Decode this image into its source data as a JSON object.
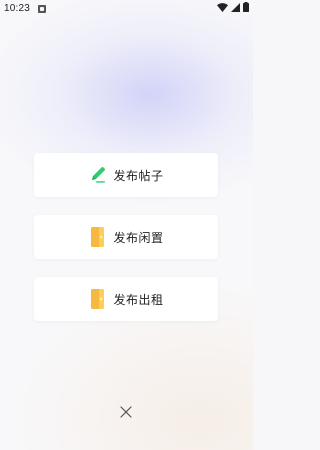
{
  "status_bar": {
    "time": "10:23",
    "icons": [
      "app-notification-icon",
      "wifi-icon",
      "signal-icon",
      "battery-icon"
    ]
  },
  "menu": {
    "items": [
      {
        "label": "发布帖子",
        "icon": "pencil-icon",
        "accent": "#2ecc71"
      },
      {
        "label": "发布闲置",
        "icon": "door-icon",
        "accent": "#f5b841"
      },
      {
        "label": "发布出租",
        "icon": "door-icon",
        "accent": "#f5b841"
      }
    ]
  },
  "close": {
    "icon": "close-icon"
  }
}
